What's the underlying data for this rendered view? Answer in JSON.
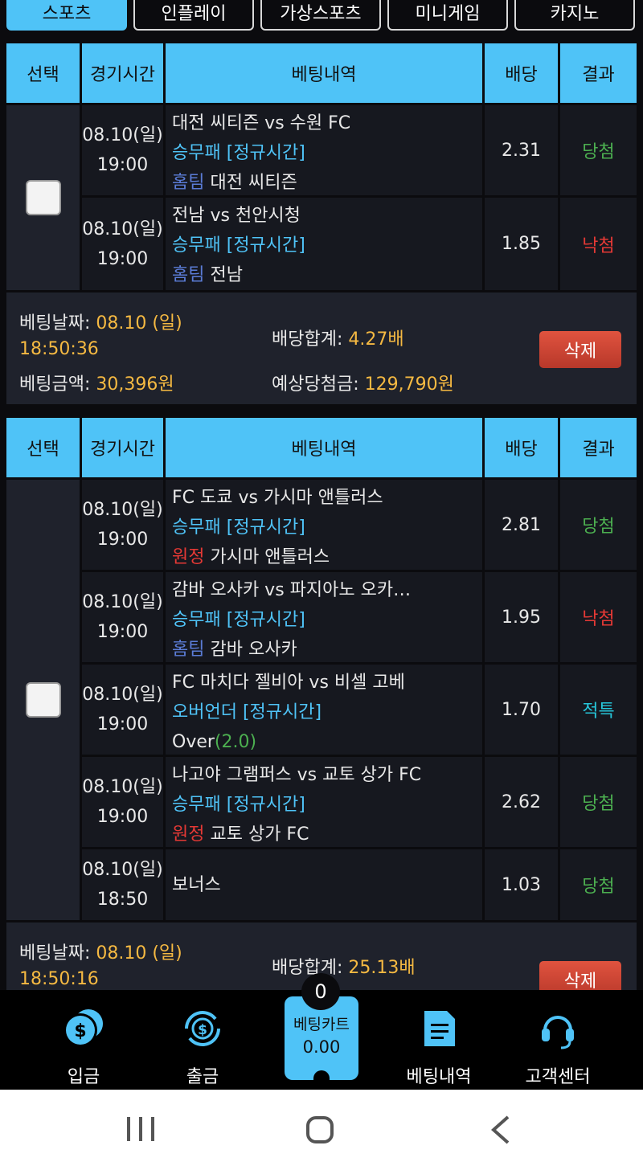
{
  "tabs": [
    {
      "label": "스포츠",
      "active": true
    },
    {
      "label": "인플레이"
    },
    {
      "label": "가상스포츠"
    },
    {
      "label": "미니게임"
    },
    {
      "label": "카지노"
    }
  ],
  "table_header": {
    "select": "선택",
    "time": "경기시간",
    "detail": "베팅내역",
    "odds": "배당",
    "result": "결과"
  },
  "bets": [
    {
      "rows": [
        {
          "date": "08.10(일)",
          "time": "19:00",
          "match": "대전 씨티즌 vs 수원 FC",
          "market": "승무패",
          "period": "[정규시간]",
          "pick_side": "홈팀",
          "pick": "대전 씨티즌",
          "odds": "2.31",
          "result": "당첨"
        },
        {
          "date": "08.10(일)",
          "time": "19:00",
          "match": "전남 vs 천안시청",
          "market": "승무패",
          "period": "[정규시간]",
          "pick_side": "홈팀",
          "pick": "전남",
          "odds": "1.85",
          "result": "낙첨"
        }
      ],
      "summary": {
        "date_label": "베팅날짜:",
        "date_value": "08.10 (일)",
        "time_value": "18:50:36",
        "amount_label": "베팅금액:",
        "amount_value": "30,396원",
        "total_odds_label": "배당합계:",
        "total_odds_value": "4.27배",
        "expected_label": "예상당첨금:",
        "expected_value": "129,790원",
        "delete_label": "삭제"
      }
    },
    {
      "rows": [
        {
          "date": "08.10(일)",
          "time": "19:00",
          "match": "FC 도쿄 vs 가시마 앤틀러스",
          "market": "승무패",
          "period": "[정규시간]",
          "pick_side": "원정",
          "pick": "가시마 앤틀러스",
          "odds": "2.81",
          "result": "당첨"
        },
        {
          "date": "08.10(일)",
          "time": "19:00",
          "match": "감바 오사카 vs 파지아노 오카…",
          "market": "승무패",
          "period": "[정규시간]",
          "pick_side": "홈팀",
          "pick": "감바 오사카",
          "odds": "1.95",
          "result": "낙첨"
        },
        {
          "date": "08.10(일)",
          "time": "19:00",
          "match": "FC 마치다 젤비아 vs 비셀 고베",
          "market": "오버언더",
          "period": "[정규시간]",
          "pick": "Over",
          "pick_line": "(2.0)",
          "odds": "1.70",
          "result": "적특"
        },
        {
          "date": "08.10(일)",
          "time": "19:00",
          "match": "나고야 그램퍼스 vs 교토 상가 FC",
          "market": "승무패",
          "period": "[정규시간]",
          "pick_side": "원정",
          "pick": "교토 상가 FC",
          "odds": "2.62",
          "result": "당첨"
        },
        {
          "date": "08.10(일)",
          "time": "18:50",
          "match": "보너스",
          "odds": "1.03",
          "result": "당첨"
        }
      ],
      "summary": {
        "date_label": "베팅날짜:",
        "date_value": "08.10 (일)",
        "time_value": "18:50:16",
        "total_odds_label": "배당합계:",
        "total_odds_value": "25.13배",
        "delete_label": "삭제"
      }
    }
  ],
  "bottom_nav": {
    "deposit": "입금",
    "withdraw": "출금",
    "cart_label": "베팅카트",
    "cart_value": "0.00",
    "cart_count": "0",
    "history": "베팅내역",
    "support": "고객센터"
  },
  "colors": {
    "accent": "#4fc3f7",
    "win": "#4caf50",
    "lose": "#e53935",
    "refund": "#26c6da",
    "gold": "#f5b942"
  }
}
